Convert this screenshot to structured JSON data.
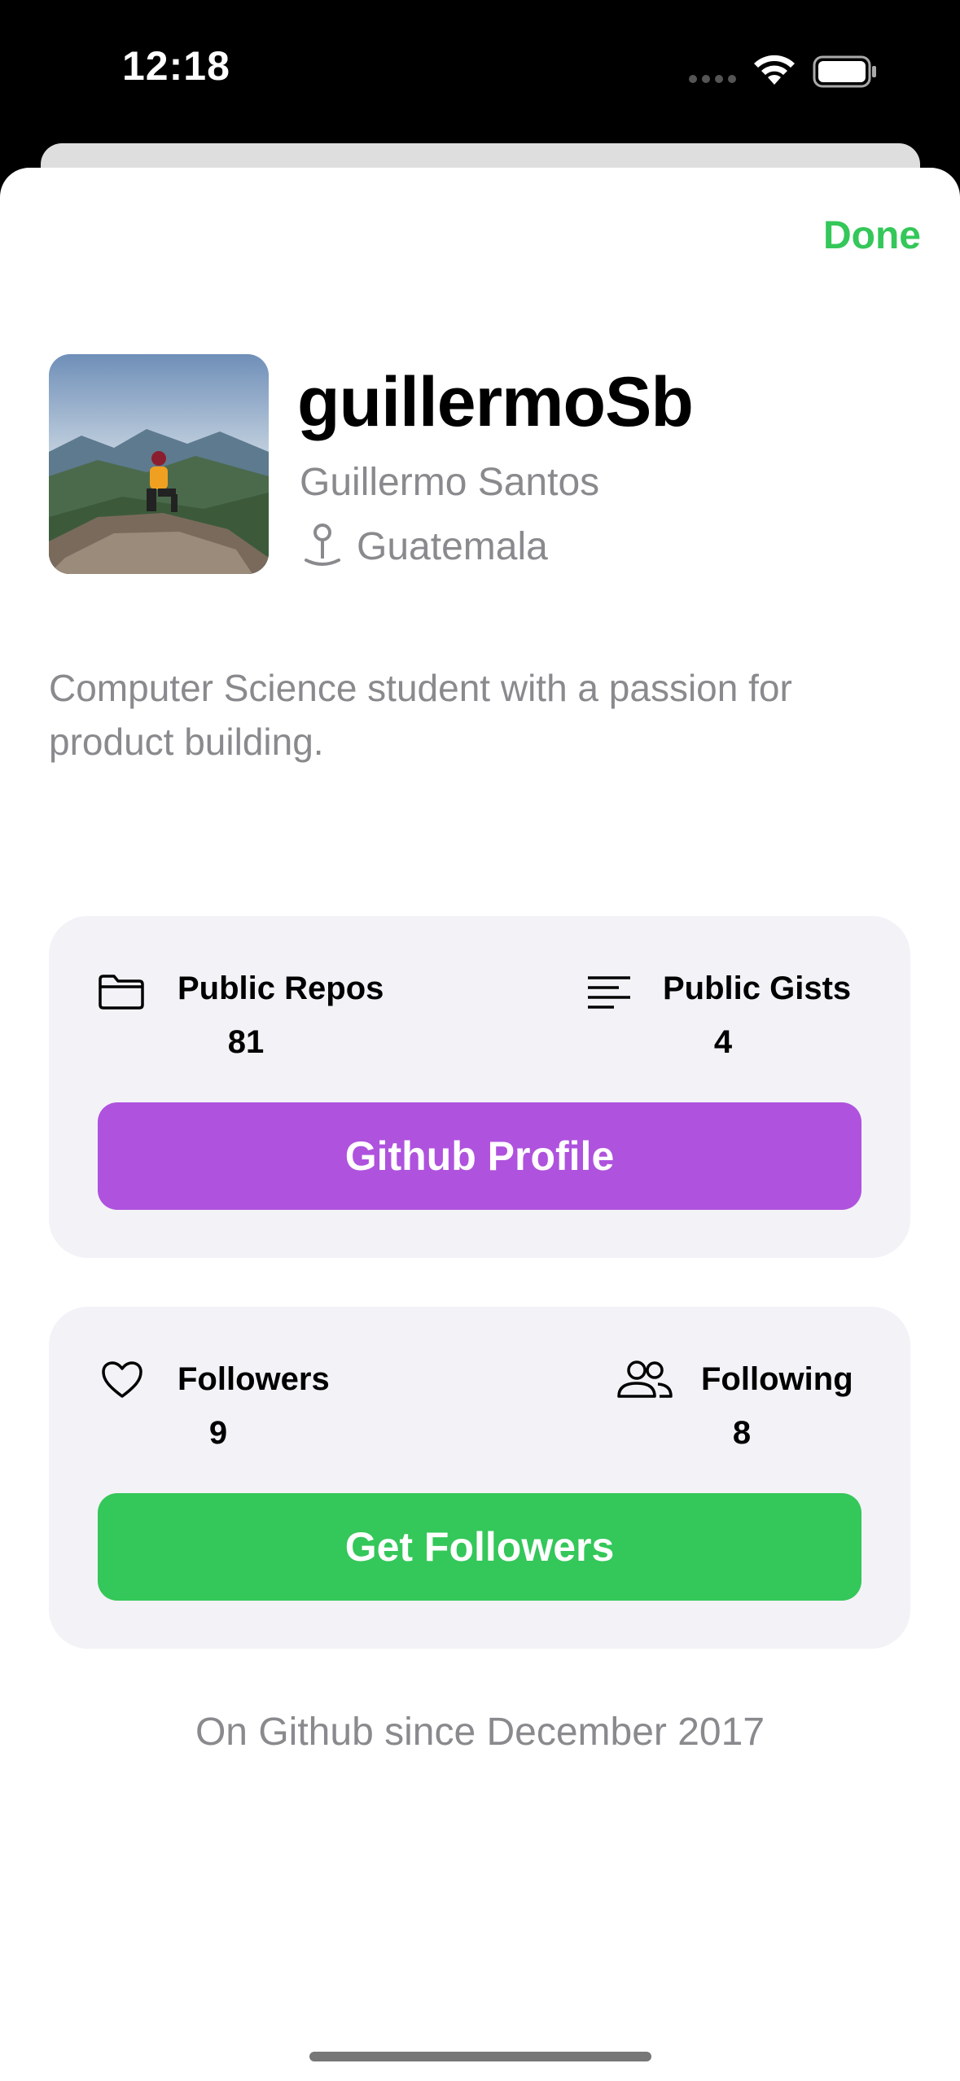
{
  "status_bar": {
    "time": "12:18"
  },
  "header": {
    "done_label": "Done"
  },
  "profile": {
    "username": "guillermoSb",
    "full_name": "Guillermo Santos",
    "location": "Guatemala",
    "bio": "Computer Science student with a passion for product building."
  },
  "repos_card": {
    "public_repos_label": "Public Repos",
    "public_repos_value": "81",
    "public_gists_label": "Public Gists",
    "public_gists_value": "4",
    "button_label": "Github Profile",
    "button_color": "#af52de"
  },
  "followers_card": {
    "followers_label": "Followers",
    "followers_value": "9",
    "following_label": "Following",
    "following_value": "8",
    "button_label": "Get Followers",
    "button_color": "#34c759"
  },
  "footer": {
    "since_text": "On Github since December 2017"
  },
  "icons": {
    "folder": "folder-icon",
    "gists": "text-align-left-icon",
    "followers": "heart-icon",
    "following": "person-2-icon",
    "location": "mappin-icon"
  }
}
